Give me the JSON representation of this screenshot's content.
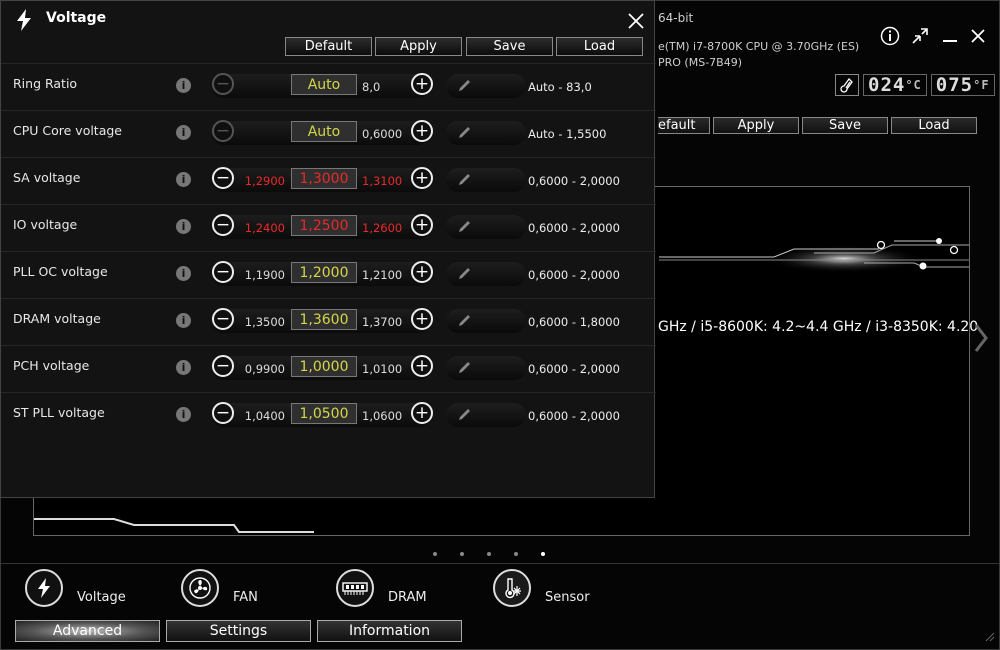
{
  "window": {
    "os_text": "64-bit",
    "cpu_text": "e(TM) i7-8700K CPU @ 3.70GHz (ES)",
    "board_text": "PRO (MS-7B49)",
    "buttons": [
      "Default",
      "Apply",
      "Save",
      "Load"
    ],
    "default_partial": "efault",
    "temp": {
      "c_value": "024",
      "c_unit": "°C",
      "f_value": "075",
      "f_unit": "°F"
    },
    "cpu_info": "GHz / i5-8600K: 4.2~4.4 GHz / i3-8350K: 4.20",
    "dots": 5,
    "active_dot": 4
  },
  "nav": [
    {
      "label": "Voltage",
      "icon": "lightning-icon"
    },
    {
      "label": "FAN",
      "icon": "fan-icon"
    },
    {
      "label": "DRAM",
      "icon": "dram-icon"
    },
    {
      "label": "Sensor",
      "icon": "thermometer-icon"
    }
  ],
  "tabs": [
    "Advanced",
    "Settings",
    "Information"
  ],
  "dialog": {
    "title": "Voltage",
    "buttons": [
      "Default",
      "Apply",
      "Save",
      "Load"
    ],
    "rows": [
      {
        "label": "Ring Ratio",
        "low": "",
        "current": "Auto",
        "high": "8,0",
        "range": "Auto - 83,0",
        "minus_enabled": false,
        "red": false
      },
      {
        "label": "CPU Core voltage",
        "low": "",
        "current": "Auto",
        "high": "0,6000",
        "range": "Auto - 1,5500",
        "minus_enabled": false,
        "red": false
      },
      {
        "label": "SA voltage",
        "low": "1,2900",
        "current": "1,3000",
        "high": "1,3100",
        "range": "0,6000 - 2,0000",
        "minus_enabled": true,
        "red": true
      },
      {
        "label": "IO voltage",
        "low": "1,2400",
        "current": "1,2500",
        "high": "1,2600",
        "range": "0,6000 - 2,0000",
        "minus_enabled": true,
        "red": true
      },
      {
        "label": "PLL OC voltage",
        "low": "1,1900",
        "current": "1,2000",
        "high": "1,2100",
        "range": "0,6000 - 2,0000",
        "minus_enabled": true,
        "red": false
      },
      {
        "label": "DRAM voltage",
        "low": "1,3500",
        "current": "1,3600",
        "high": "1,3700",
        "range": "0,6000 - 1,8000",
        "minus_enabled": true,
        "red": false
      },
      {
        "label": "PCH voltage",
        "low": "0,9900",
        "current": "1,0000",
        "high": "1,0100",
        "range": "0,6000 - 2,0000",
        "minus_enabled": true,
        "red": false
      },
      {
        "label": "ST PLL voltage",
        "low": "1,0400",
        "current": "1,0500",
        "high": "1,0600",
        "range": "0,6000 - 2,0000",
        "minus_enabled": true,
        "red": false
      }
    ]
  }
}
